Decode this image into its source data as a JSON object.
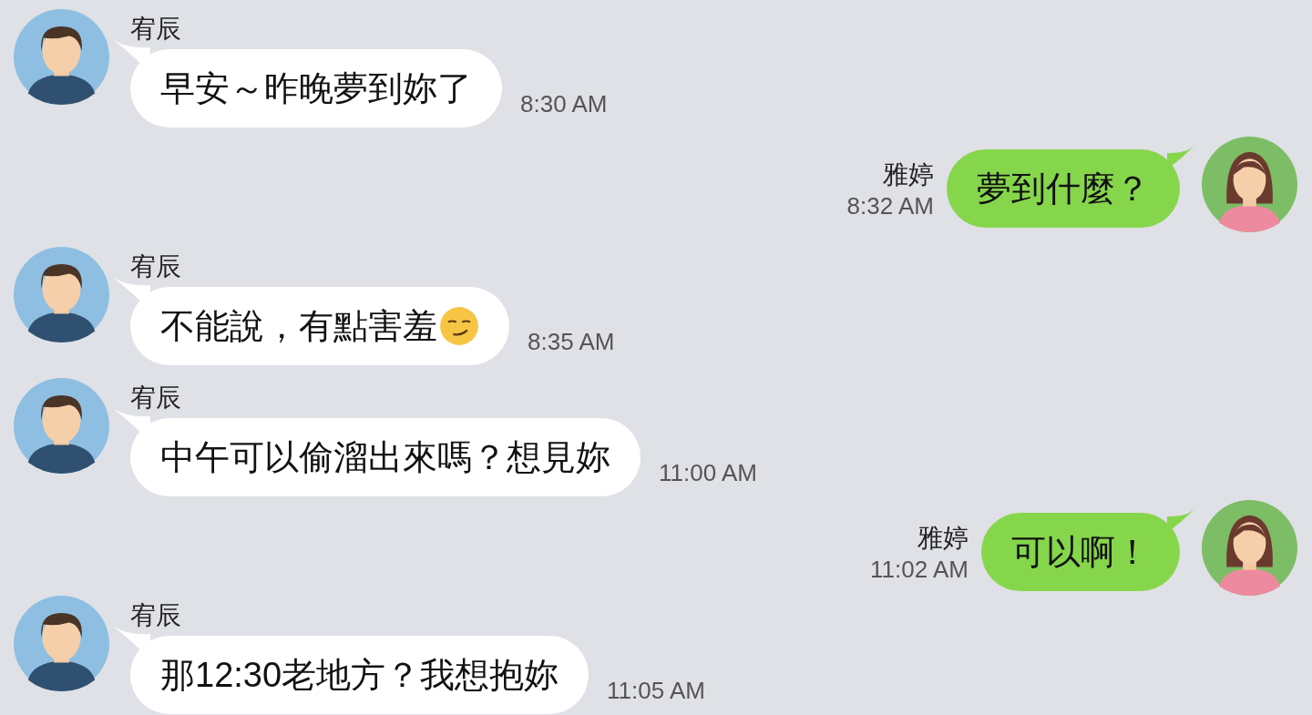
{
  "messages": [
    {
      "kind": "incoming",
      "sender": "宥辰",
      "text": "早安～昨晚夢到妳了",
      "time": "8:30 AM"
    },
    {
      "kind": "outgoing",
      "sender": "雅婷",
      "text": "夢到什麼？",
      "time": "8:32 AM"
    },
    {
      "kind": "incoming",
      "sender": "宥辰",
      "text": "不能說，有點害羞",
      "has_emoji": true,
      "time": "8:35 AM"
    },
    {
      "kind": "incoming",
      "sender": "宥辰",
      "text": "中午可以偷溜出來嗎？想見妳",
      "time": "11:00 AM"
    },
    {
      "kind": "outgoing",
      "sender": "雅婷",
      "text": "可以啊！",
      "time": "11:02 AM"
    },
    {
      "kind": "incoming",
      "sender": "宥辰",
      "text": "那12:30老地方？我想抱妳",
      "time": "11:05 AM"
    }
  ]
}
